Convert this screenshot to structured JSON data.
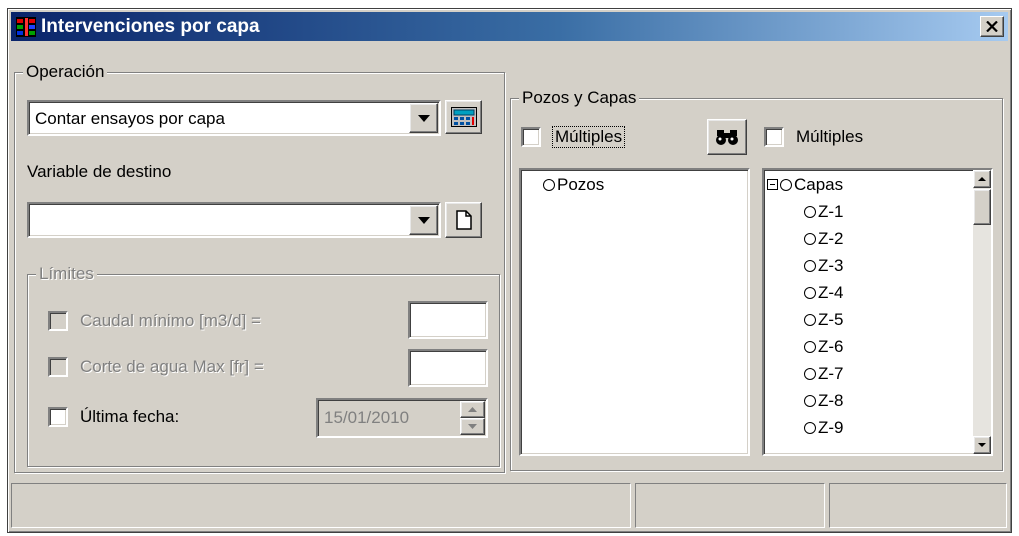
{
  "window": {
    "title": "Intervenciones por capa",
    "close_label": "X"
  },
  "operacion": {
    "legend": "Operación",
    "operation_value": "Contar ensayos por capa",
    "target_label": "Variable de destino",
    "target_value": ""
  },
  "limites": {
    "legend": "Límites",
    "caudal_label": "Caudal mínimo [m3/d] =",
    "caudal_value": "",
    "corte_label": "Corte de agua Max [fr] =",
    "corte_value": "",
    "fecha_label": "Última fecha:",
    "fecha_value": "15/01/2010"
  },
  "pozos_capas": {
    "legend": "Pozos y Capas",
    "multiples_left_label": "Múltiples",
    "multiples_right_label": "Múltiples",
    "pozos_root": "Pozos",
    "capas_root": "Capas",
    "capas": [
      "Z-1",
      "Z-2",
      "Z-3",
      "Z-4",
      "Z-5",
      "Z-6",
      "Z-7",
      "Z-8",
      "Z-9"
    ]
  },
  "colors": {
    "title_start": "#0a246a",
    "title_end": "#a6caf0",
    "face": "#d4d0c8"
  }
}
